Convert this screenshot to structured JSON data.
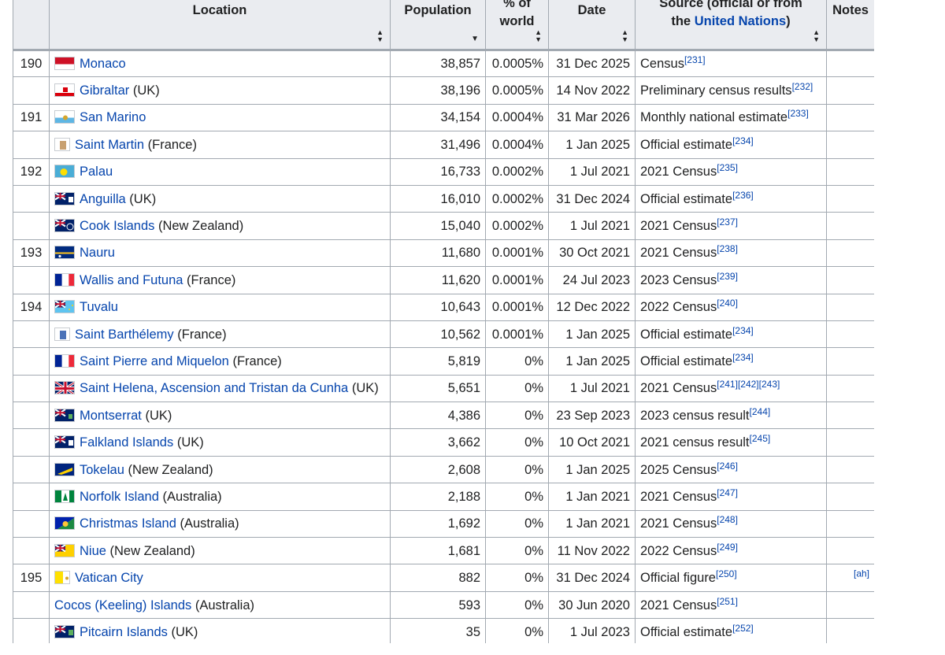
{
  "headers": {
    "location": "Location",
    "population": "Population",
    "pct_world_line1": "% of",
    "pct_world_line2": "world",
    "date": "Date",
    "source_line1": "Source (official or from",
    "source_line2_prefix": "the ",
    "source_line2_link": "United Nations",
    "source_line2_suffix": ")",
    "notes": "Notes"
  },
  "rows": [
    {
      "rank": "190",
      "name": "Monaco",
      "parent": "",
      "population": "38,857",
      "pct": "0.0005%",
      "date": "31 Dec 2025",
      "source": "Census",
      "refs": [
        "[231]"
      ],
      "note": ""
    },
    {
      "rank": "",
      "name": "Gibraltar",
      "parent": " (UK)",
      "population": "38,196",
      "pct": "0.0005%",
      "date": "14 Nov 2022",
      "source": "Preliminary census results",
      "refs": [
        "[232]"
      ],
      "note": ""
    },
    {
      "rank": "191",
      "name": "San Marino",
      "parent": "",
      "population": "34,154",
      "pct": "0.0004%",
      "date": "31 Mar 2026",
      "source": "Monthly national estimate",
      "refs": [
        "[233]"
      ],
      "note": ""
    },
    {
      "rank": "",
      "name": "Saint Martin",
      "parent": " (France)",
      "population": "31,496",
      "pct": "0.0004%",
      "date": "1 Jan 2025",
      "source": "Official estimate",
      "refs": [
        "[234]"
      ],
      "note": ""
    },
    {
      "rank": "192",
      "name": "Palau",
      "parent": "",
      "population": "16,733",
      "pct": "0.0002%",
      "date": "1 Jul 2021",
      "source": "2021 Census",
      "refs": [
        "[235]"
      ],
      "note": ""
    },
    {
      "rank": "",
      "name": "Anguilla",
      "parent": " (UK)",
      "population": "16,010",
      "pct": "0.0002%",
      "date": "31 Dec 2024",
      "source": "Official estimate",
      "refs": [
        "[236]"
      ],
      "note": ""
    },
    {
      "rank": "",
      "name": "Cook Islands",
      "parent": " (New Zealand)",
      "population": "15,040",
      "pct": "0.0002%",
      "date": "1 Jul 2021",
      "source": "2021 Census",
      "refs": [
        "[237]"
      ],
      "note": ""
    },
    {
      "rank": "193",
      "name": "Nauru",
      "parent": "",
      "population": "11,680",
      "pct": "0.0001%",
      "date": "30 Oct 2021",
      "source": "2021 Census",
      "refs": [
        "[238]"
      ],
      "note": ""
    },
    {
      "rank": "",
      "name": "Wallis and Futuna",
      "parent": " (France)",
      "population": "11,620",
      "pct": "0.0001%",
      "date": "24 Jul 2023",
      "source": "2023 Census",
      "refs": [
        "[239]"
      ],
      "note": ""
    },
    {
      "rank": "194",
      "name": "Tuvalu",
      "parent": "",
      "population": "10,643",
      "pct": "0.0001%",
      "date": "12 Dec 2022",
      "source": "2022 Census",
      "refs": [
        "[240]"
      ],
      "note": ""
    },
    {
      "rank": "",
      "name": "Saint Barthélemy",
      "parent": " (France)",
      "population": "10,562",
      "pct": "0.0001%",
      "date": "1 Jan 2025",
      "source": "Official estimate",
      "refs": [
        "[234]"
      ],
      "note": ""
    },
    {
      "rank": "",
      "name": "Saint Pierre and Miquelon",
      "parent": " (France)",
      "population": "5,819",
      "pct": "0%",
      "date": "1 Jan 2025",
      "source": "Official estimate",
      "refs": [
        "[234]"
      ],
      "note": ""
    },
    {
      "rank": "",
      "name": "Saint Helena, Ascension and Tristan da Cunha",
      "parent": " (UK)",
      "population": "5,651",
      "pct": "0%",
      "date": "1 Jul 2021",
      "source": "2021 Census",
      "refs": [
        "[241]",
        "[242]",
        "[243]"
      ],
      "note": ""
    },
    {
      "rank": "",
      "name": "Montserrat",
      "parent": " (UK)",
      "population": "4,386",
      "pct": "0%",
      "date": "23 Sep 2023",
      "source": "2023 census result",
      "refs": [
        "[244]"
      ],
      "note": ""
    },
    {
      "rank": "",
      "name": "Falkland Islands",
      "parent": " (UK)",
      "population": "3,662",
      "pct": "0%",
      "date": "10 Oct 2021",
      "source": "2021 census result",
      "refs": [
        "[245]"
      ],
      "note": ""
    },
    {
      "rank": "",
      "name": "Tokelau",
      "parent": " (New Zealand)",
      "population": "2,608",
      "pct": "0%",
      "date": "1 Jan 2025",
      "source": "2025 Census",
      "refs": [
        "[246]"
      ],
      "note": ""
    },
    {
      "rank": "",
      "name": "Norfolk Island",
      "parent": " (Australia)",
      "population": "2,188",
      "pct": "0%",
      "date": "1 Jan 2021",
      "source": "2021 Census",
      "refs": [
        "[247]"
      ],
      "note": ""
    },
    {
      "rank": "",
      "name": "Christmas Island",
      "parent": " (Australia)",
      "population": "1,692",
      "pct": "0%",
      "date": "1 Jan 2021",
      "source": "2021 Census",
      "refs": [
        "[248]"
      ],
      "note": ""
    },
    {
      "rank": "",
      "name": "Niue",
      "parent": " (New Zealand)",
      "population": "1,681",
      "pct": "0%",
      "date": "11 Nov 2022",
      "source": "2022 Census",
      "refs": [
        "[249]"
      ],
      "note": ""
    },
    {
      "rank": "195",
      "name": "Vatican City",
      "parent": "",
      "population": "882",
      "pct": "0%",
      "date": "31 Dec 2024",
      "source": "Official figure",
      "refs": [
        "[250]"
      ],
      "note": "[ah]"
    },
    {
      "rank": "",
      "name": "Cocos (Keeling) Islands",
      "parent": " (Australia)",
      "population": "593",
      "pct": "0%",
      "date": "30 Jun 2020",
      "source": "2021 Census",
      "refs": [
        "[251]"
      ],
      "note": ""
    },
    {
      "rank": "",
      "name": "Pitcairn Islands",
      "parent": " (UK)",
      "population": "35",
      "pct": "0%",
      "date": "1 Jul 2023",
      "source": "Official estimate",
      "refs": [
        "[252]"
      ],
      "note": ""
    }
  ],
  "flags": [
    "monaco-flag",
    "gibraltar-flag",
    "san-marino-flag",
    "saint-martin-flag",
    "palau-flag",
    "anguilla-flag",
    "cook-islands-flag",
    "nauru-flag",
    "wallis-futuna-flag",
    "tuvalu-flag",
    "saint-barthelemy-flag",
    "saint-pierre-miquelon-flag",
    "saint-helena-flag",
    "montserrat-flag",
    "falkland-islands-flag",
    "tokelau-flag",
    "norfolk-island-flag",
    "christmas-island-flag",
    "niue-flag",
    "vatican-city-flag",
    "",
    "pitcairn-islands-flag"
  ],
  "colors": {
    "link": "#0645ad",
    "header_bg": "#eaecf0",
    "border": "#a2a9b1"
  }
}
